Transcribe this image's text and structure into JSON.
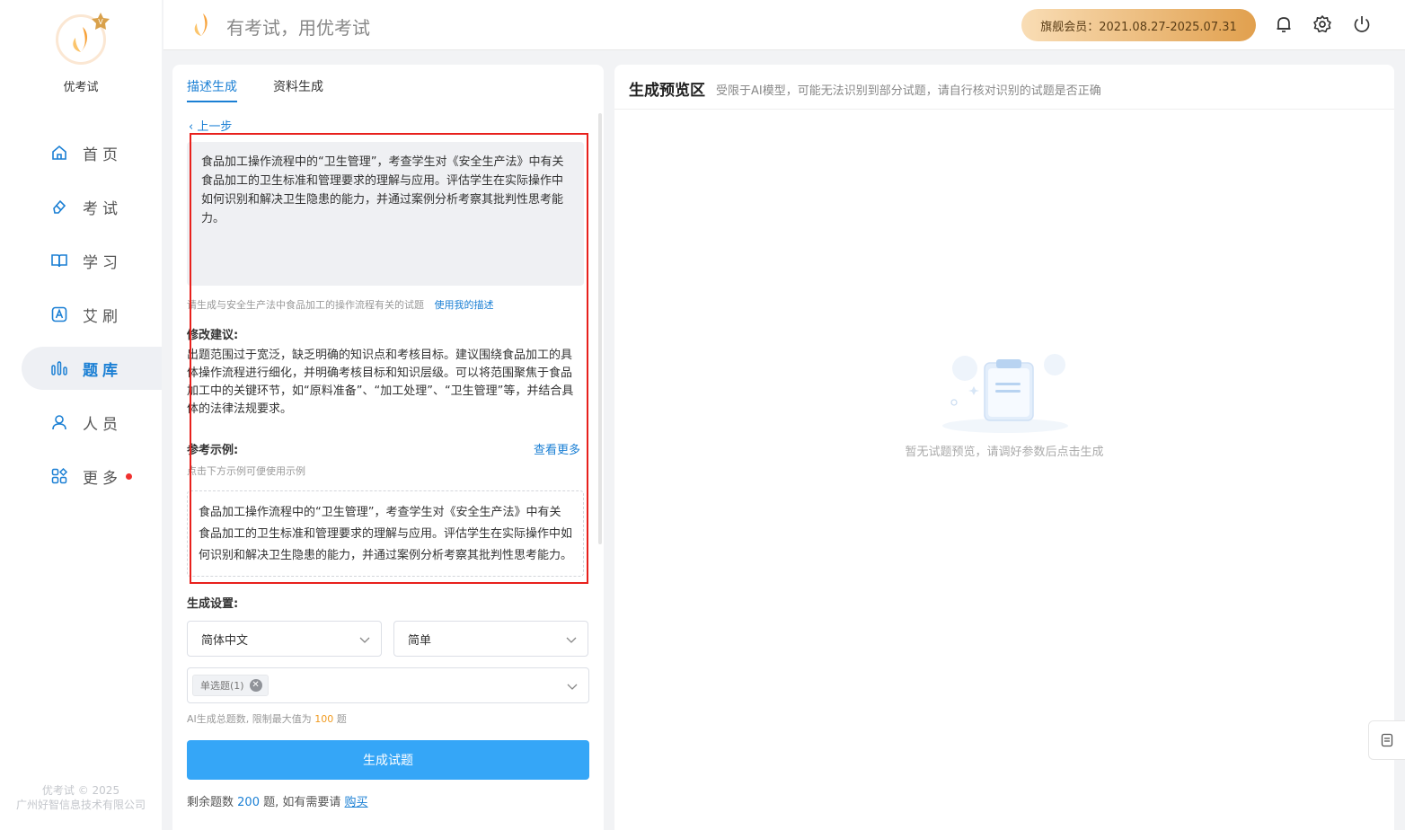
{
  "brand": {
    "name": "优考试",
    "slogan": "有考试，用优考试",
    "copyright_line1": "优考试 © 2025",
    "copyright_line2": "广州好智信息技术有限公司"
  },
  "header": {
    "member_label": "旗舰会员：2021.08.27-2025.07.31"
  },
  "sidebar": {
    "items": [
      {
        "label": "首页",
        "icon": "home-icon",
        "active": false
      },
      {
        "label": "考试",
        "icon": "eraser-icon",
        "active": false
      },
      {
        "label": "学习",
        "icon": "book-icon",
        "active": false
      },
      {
        "label": "艾刷",
        "icon": "letter-a-icon",
        "active": false
      },
      {
        "label": "题库",
        "icon": "bar-chart-icon",
        "active": true
      },
      {
        "label": "人员",
        "icon": "user-icon",
        "active": false
      },
      {
        "label": "更多",
        "icon": "apps-icon",
        "active": false
      }
    ]
  },
  "left": {
    "tabs": [
      {
        "label": "描述生成",
        "active": true
      },
      {
        "label": "资料生成",
        "active": false
      }
    ],
    "back_label": "上一步",
    "description": "食品加工操作流程中的“卫生管理”，考查学生对《安全生产法》中有关食品加工的卫生标准和管理要求的理解与应用。评估学生在实际操作中如何识别和解决卫生隐患的能力，并通过案例分析考察其批判性思考能力。",
    "hint": "请生成与安全生产法中食品加工的操作流程有关的试题",
    "use_desc": "使用我的描述",
    "suggest_title": "修改建议:",
    "suggest_text": "出题范围过于宽泛，缺乏明确的知识点和考核目标。建议围绕食品加工的具体操作流程进行细化，并明确考核目标和知识层级。可以将范围聚焦于食品加工中的关键环节，如“原料准备”、“加工处理”、“卫生管理”等，并结合具体的法律法规要求。",
    "example_title": "参考示例:",
    "see_more": "查看更多",
    "example_hint": "点击下方示例可便使用示例",
    "example_text": "食品加工操作流程中的“卫生管理”，考查学生对《安全生产法》中有关食品加工的卫生标准和管理要求的理解与应用。评估学生在实际操作中如何识别和解决卫生隐患的能力，并通过案例分析考察其批判性思考能力。",
    "settings_title": "生成设置:",
    "language": "简体中文",
    "difficulty": "简单",
    "question_tag": "单选题(1)",
    "limit_prefix": "AI生成总题数, 限制最大值为",
    "limit_value": "100",
    "limit_suffix": "题",
    "generate_btn": "生成试题",
    "remain_prefix": "剩余题数",
    "remain_value": "200",
    "remain_mid": "题, 如有需要请",
    "buy": "购买"
  },
  "right": {
    "title": "生成预览区",
    "subtitle": "受限于AI模型，可能无法识别到部分试题，请自行核对识别的试题是否正确",
    "empty_text": "暂无试题预览，请调好参数后点击生成"
  },
  "colors": {
    "accent": "#1a7fd4",
    "button": "#35a6f7",
    "annotation": "#e8201c"
  }
}
